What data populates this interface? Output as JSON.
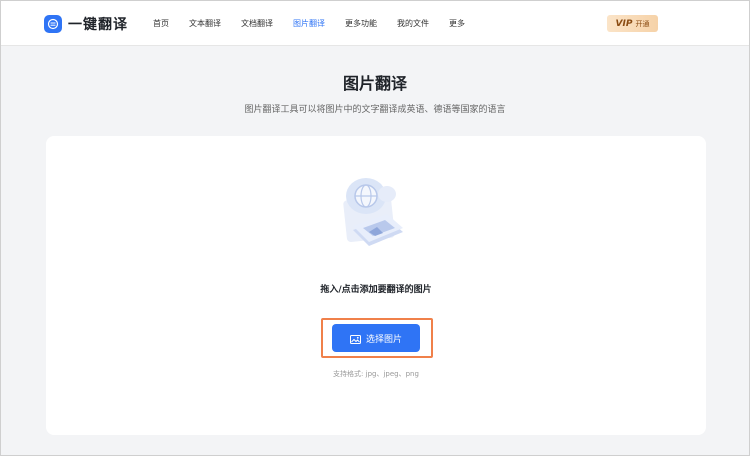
{
  "header": {
    "logo_text": "一键翻译",
    "nav": [
      {
        "label": "首页",
        "active": false
      },
      {
        "label": "文本翻译",
        "active": false
      },
      {
        "label": "文档翻译",
        "active": false
      },
      {
        "label": "图片翻译",
        "active": true
      },
      {
        "label": "更多功能",
        "active": false
      },
      {
        "label": "我的文件",
        "active": false
      },
      {
        "label": "更多",
        "active": false
      }
    ],
    "vip": {
      "tag": "VIP",
      "label": "开通"
    }
  },
  "main": {
    "title": "图片翻译",
    "subtitle": "图片翻译工具可以将图片中的文字翻译成英语、德语等国家的语言",
    "upload": {
      "hint": "拖入/点击添加要翻译的图片",
      "button_label": "选择图片",
      "formats": "支持格式: jpg、jpeg、png"
    }
  },
  "colors": {
    "accent": "#2f74f5",
    "highlight_border": "#f0804a",
    "background": "#f3f4f6"
  },
  "icons": [
    "logo-icon",
    "globe-icon",
    "image-icon"
  ]
}
